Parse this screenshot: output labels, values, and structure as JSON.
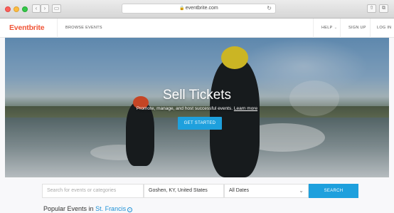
{
  "browser": {
    "url": "eventbrite.com",
    "back_glyph": "‹",
    "forward_glyph": "›",
    "sidebar_glyph": "▭",
    "reload_glyph": "↻",
    "share_glyph": "⇧",
    "tabs_glyph": "⧉"
  },
  "header": {
    "logo": "Eventbrite",
    "browse": "BROWSE EVENTS",
    "help": "HELP",
    "help_chevron": "⌄",
    "signup": "SIGN UP",
    "login": "LOG IN"
  },
  "hero": {
    "title": "Sell Tickets",
    "subtitle": "Promote, manage, and host successful events.",
    "learn_more": "Learn more",
    "cta": "GET STARTED"
  },
  "search": {
    "query_placeholder": "Search for events or categories",
    "location": "Goshen, KY, United States",
    "dates": "All Dates",
    "dates_chevron": "⌄",
    "button": "SEARCH"
  },
  "popular": {
    "prefix": "Popular Events in",
    "city": "St. Francis",
    "change_glyph": "⌄"
  },
  "colors": {
    "brand": "#f05537",
    "accent": "#1ea0dd"
  }
}
